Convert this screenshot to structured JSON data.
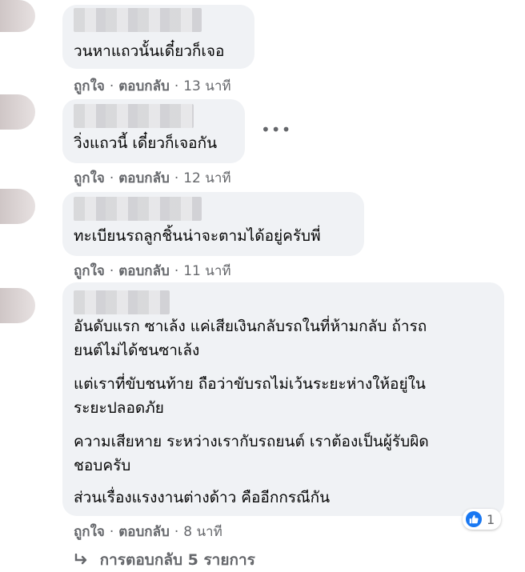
{
  "comments": [
    {
      "lines": [
        "วนหาแถวนั้นเดี๋ยวก็เจอ"
      ],
      "like": "ถูกใจ",
      "reply": "ตอบกลับ",
      "time": "13 นาที"
    },
    {
      "lines": [
        "วิ่งแถวนี้ เดี๋ยวก็เจอกัน"
      ],
      "like": "ถูกใจ",
      "reply": "ตอบกลับ",
      "time": "12 นาที",
      "more_icon": "more-options-icon"
    },
    {
      "lines": [
        "ทะเบียนรถลูกชิ้นน่าจะตามได้อยู่ครับพี่"
      ],
      "like": "ถูกใจ",
      "reply": "ตอบกลับ",
      "time": "11 นาที"
    },
    {
      "lines": [
        "อันดับแรก ซาเล้ง แค่เสียเงินกลับรถในที่ห้ามกลับ ถ้ารถ",
        "ยนต์ไม่ได้ชนซาเล้ง",
        "แต่เราที่ขับชนท้าย ถือว่าขับรถไม่เว้นระยะห่างให้อยู่ใน",
        "ระยะปลอดภัย",
        "ความเสียหาย ระหว่างเรากับรถยนต์ เราต้องเป็นผู้รับผิด",
        "ชอบครับ",
        "ส่วนเรื่องแรงงานต่างด้าว คืออีกกรณีกัน"
      ],
      "like": "ถูกใจ",
      "reply": "ตอบกลับ",
      "time": "8 นาที",
      "reaction_count": "1",
      "reaction_icon": "like-thumb-icon"
    }
  ],
  "view_replies": {
    "label": "การตอบกลับ 5 รายการ",
    "icon": "reply-arrow-icon"
  },
  "colors": {
    "bubble": "#f0f2f5",
    "meta_text": "#65676b",
    "like_blue": "#1877f2"
  }
}
